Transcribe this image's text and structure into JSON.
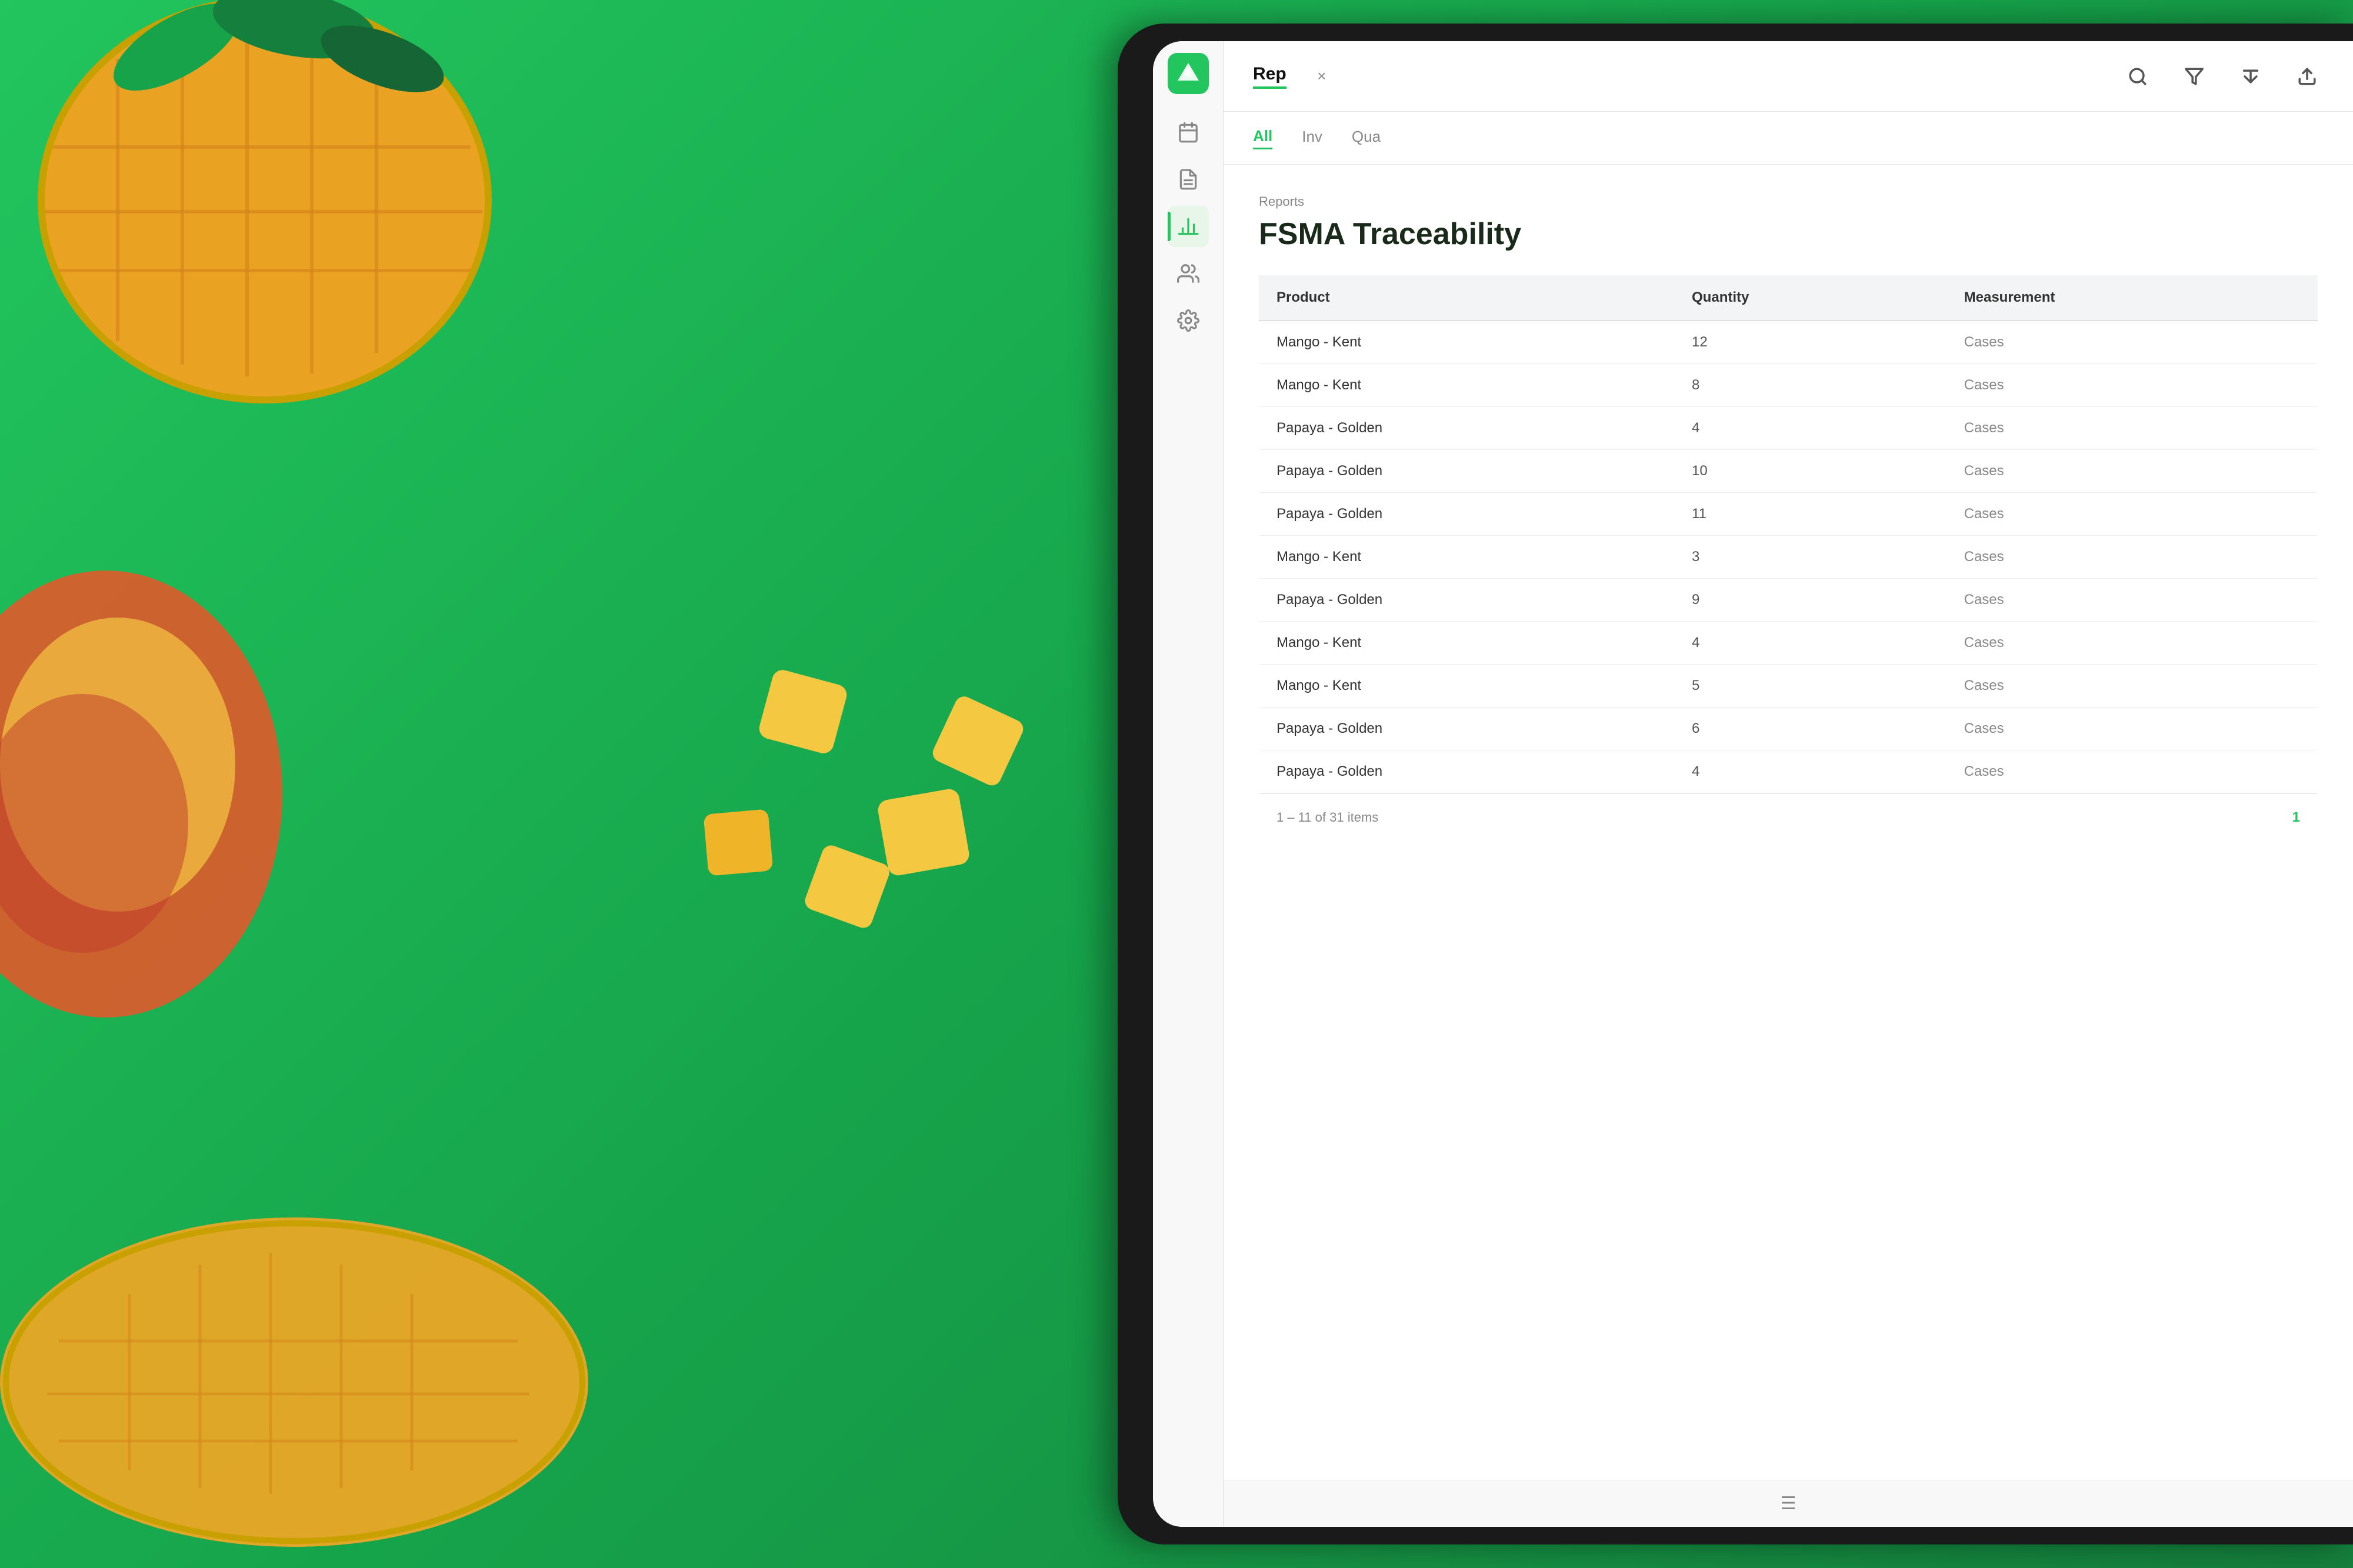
{
  "background": {
    "color": "#22c55e"
  },
  "sidebar": {
    "logo_alt": "Produce app logo",
    "icons": [
      {
        "name": "calendar-icon",
        "active": false
      },
      {
        "name": "document-icon",
        "active": false
      },
      {
        "name": "chart-icon",
        "active": true
      },
      {
        "name": "people-icon",
        "active": false
      },
      {
        "name": "settings-icon",
        "active": false
      }
    ]
  },
  "topbar": {
    "tab_label": "Rep",
    "close_label": "×",
    "icons": [
      "search-icon",
      "filter-icon",
      "sort-icon",
      "export-icon"
    ]
  },
  "sub_nav": {
    "items": [
      {
        "label": "All",
        "active": true
      },
      {
        "label": "Inv",
        "active": false
      },
      {
        "label": "Qua",
        "active": false
      }
    ]
  },
  "report": {
    "breadcrumb": "Reports",
    "title": "FSMA Traceability",
    "table": {
      "columns": [
        "Product",
        "Quantity",
        "Measurement"
      ],
      "rows": [
        {
          "product": "Mango - Kent",
          "quantity": "12",
          "measurement": "Cases"
        },
        {
          "product": "Mango - Kent",
          "quantity": "8",
          "measurement": "Cases"
        },
        {
          "product": "Papaya - Golden",
          "quantity": "4",
          "measurement": "Cases"
        },
        {
          "product": "Papaya - Golden",
          "quantity": "10",
          "measurement": "Cases"
        },
        {
          "product": "Papaya - Golden",
          "quantity": "11",
          "measurement": "Cases"
        },
        {
          "product": "Mango - Kent",
          "quantity": "3",
          "measurement": "Cases"
        },
        {
          "product": "Papaya - Golden",
          "quantity": "9",
          "measurement": "Cases"
        },
        {
          "product": "Mango - Kent",
          "quantity": "4",
          "measurement": "Cases"
        },
        {
          "product": "Mango - Kent",
          "quantity": "5",
          "measurement": "Cases"
        },
        {
          "product": "Papaya - Golden",
          "quantity": "6",
          "measurement": "Cases"
        },
        {
          "product": "Papaya - Golden",
          "quantity": "4",
          "measurement": "Cases"
        }
      ],
      "pagination": {
        "range_text": "1 – 11 of 31 items",
        "current_page": "1"
      }
    }
  },
  "bottom_bar": {
    "icon": "hamburger-menu-icon"
  }
}
